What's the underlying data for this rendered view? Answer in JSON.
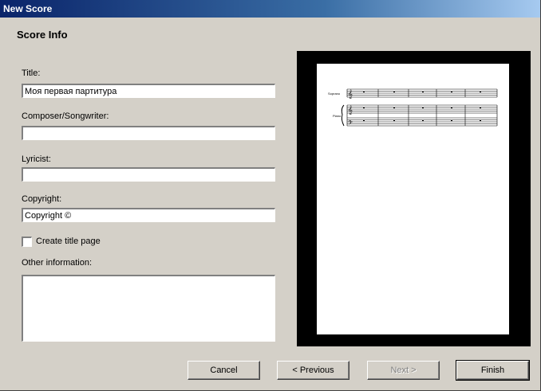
{
  "window": {
    "title": "New Score"
  },
  "header": {
    "heading": "Score Info"
  },
  "form": {
    "title_label": "Title:",
    "title_value": "Моя первая партитура",
    "composer_label": "Composer/Songwriter:",
    "composer_value": "",
    "lyricist_label": "Lyricist:",
    "lyricist_value": "",
    "copyright_label": "Copyright:",
    "copyright_value": "Copyright ©",
    "create_title_page_label": "Create title page",
    "create_title_page_checked": false,
    "other_info_label": "Other information:",
    "other_info_value": ""
  },
  "preview": {
    "staff_labels": [
      "Soprano",
      "Piano"
    ]
  },
  "buttons": {
    "cancel": "Cancel",
    "previous": "< Previous",
    "next": "Next >",
    "finish": "Finish"
  }
}
